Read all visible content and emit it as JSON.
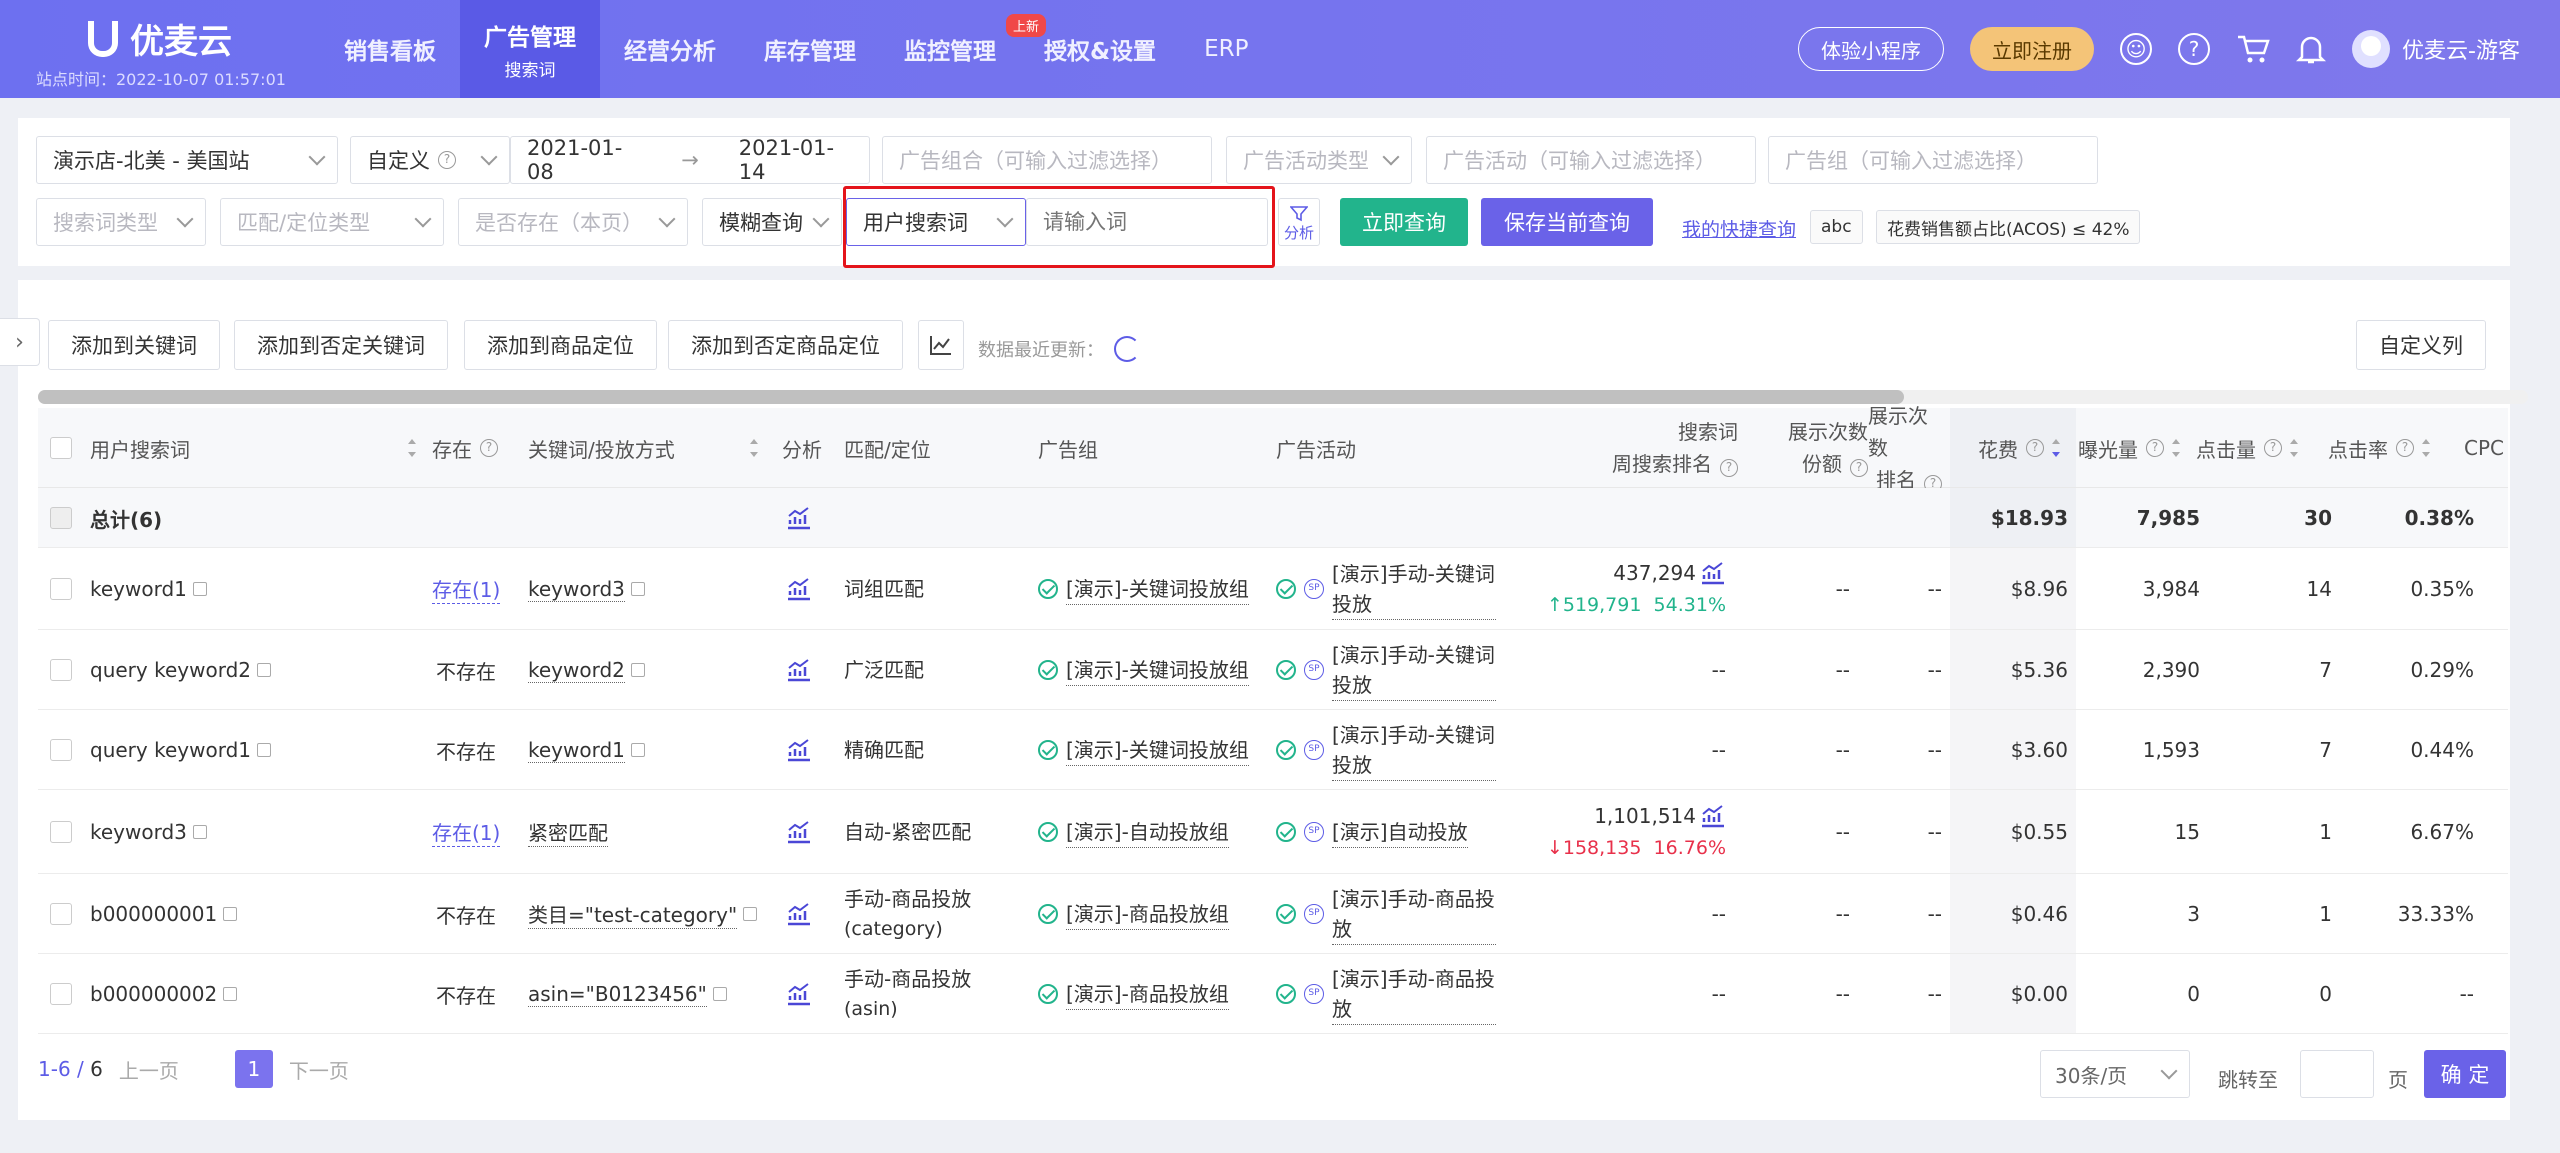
{
  "brand": {
    "name": "优麦云",
    "site_time": "站点时间：2022-10-07 01:57:01"
  },
  "nav": [
    {
      "label": "销售看板"
    },
    {
      "label": "广告管理",
      "sub": "搜索词",
      "active": true
    },
    {
      "label": "经营分析"
    },
    {
      "label": "库存管理"
    },
    {
      "label": "监控管理",
      "badge": "上新"
    },
    {
      "label": "授权&设置"
    },
    {
      "label": "ERP"
    }
  ],
  "header_right": {
    "mini_program": "体验小程序",
    "register": "立即注册",
    "username": "优麦云-游客"
  },
  "filters": {
    "store": "演示店-北美 - 美国站",
    "date_mode": "自定义",
    "date_start": "2021-01-08",
    "date_arrow": "→",
    "date_end": "2021-01-14",
    "ad_group_combo": "广告组合（可输入过滤选择）",
    "campaign_type": "广告活动类型",
    "campaign": "广告活动（可输入过滤选择）",
    "ad_group": "广告组（可输入过滤选择）",
    "search_term_type": "搜索词类型",
    "match_type": "匹配/定位类型",
    "exists": "是否存在（本页）",
    "fuzzy": "模糊查询",
    "field": "用户搜索词",
    "input_placeholder": "请输入词",
    "analyze": "分析",
    "query_btn": "立即查询",
    "save_btn": "保存当前查询",
    "quick_link": "我的快捷查询",
    "tag1": "abc",
    "tag2": "花费销售额占比(ACOS) ≤ 42%"
  },
  "toolbar": {
    "add_keyword": "添加到关键词",
    "add_neg_keyword": "添加到否定关键词",
    "add_product": "添加到商品定位",
    "add_neg_product": "添加到否定商品定位",
    "updated": "数据最近更新：",
    "custom_cols": "自定义列"
  },
  "columns": {
    "term": "用户搜索词",
    "exists": "存在",
    "keyword": "关键词/投放方式",
    "analyze": "分析",
    "match": "匹配/定位",
    "group": "广告组",
    "campaign": "广告活动",
    "rank1": "搜索词",
    "rank2": "周搜索排名",
    "share1": "展示次数",
    "share2": "份额",
    "srank1": "展示次数",
    "srank2": "排名",
    "spend": "花费",
    "impr": "曝光量",
    "clicks": "点击量",
    "ctr": "点击率",
    "cpc": "CPC"
  },
  "total": {
    "label": "总计(6)",
    "spend": "$18.93",
    "impr": "7,985",
    "clicks": "30",
    "ctr": "0.38%"
  },
  "rows": [
    {
      "term": "keyword1",
      "exists": "存在(1)",
      "exists_link": true,
      "keyword": "keyword3",
      "match": "词组匹配",
      "group": "[演示]-关键词投放组",
      "campaign": "[演示]手动-关键词投放",
      "rank": "437,294",
      "rank_delta": "519,791",
      "rank_pct": "54.31%",
      "rank_dir": "up",
      "share": "--",
      "srank": "--",
      "spend": "$8.96",
      "impr": "3,984",
      "clicks": "14",
      "ctr": "0.35%"
    },
    {
      "term": "query keyword2",
      "exists": "不存在",
      "exists_link": false,
      "keyword": "keyword2",
      "match": "广泛匹配",
      "group": "[演示]-关键词投放组",
      "campaign": "[演示]手动-关键词投放",
      "rank": "--",
      "share": "--",
      "srank": "--",
      "spend": "$5.36",
      "impr": "2,390",
      "clicks": "7",
      "ctr": "0.29%"
    },
    {
      "term": "query keyword1",
      "exists": "不存在",
      "exists_link": false,
      "keyword": "keyword1",
      "match": "精确匹配",
      "group": "[演示]-关键词投放组",
      "campaign": "[演示]手动-关键词投放",
      "rank": "--",
      "share": "--",
      "srank": "--",
      "spend": "$3.60",
      "impr": "1,593",
      "clicks": "7",
      "ctr": "0.44%"
    },
    {
      "term": "keyword3",
      "exists": "存在(1)",
      "exists_link": true,
      "keyword": "紧密匹配",
      "match": "自动-紧密匹配",
      "group": "[演示]-自动投放组",
      "campaign": "[演示]自动投放",
      "rank": "1,101,514",
      "rank_delta": "158,135",
      "rank_pct": "16.76%",
      "rank_dir": "down",
      "share": "--",
      "srank": "--",
      "spend": "$0.55",
      "impr": "15",
      "clicks": "1",
      "ctr": "6.67%"
    },
    {
      "term": "b000000001",
      "exists": "不存在",
      "exists_link": false,
      "keyword": "类目=\"test-category\"",
      "match": "手动-商品投放",
      "match_sub": "(category)",
      "group": "[演示]-商品投放组",
      "campaign": "[演示]手动-商品投放",
      "rank": "--",
      "share": "--",
      "srank": "--",
      "spend": "$0.46",
      "impr": "3",
      "clicks": "1",
      "ctr": "33.33%"
    },
    {
      "term": "b000000002",
      "exists": "不存在",
      "exists_link": false,
      "keyword": "asin=\"B0123456\"",
      "match": "手动-商品投放",
      "match_sub": "(asin)",
      "group": "[演示]-商品投放组",
      "campaign": "[演示]手动-商品投放",
      "rank": "--",
      "share": "--",
      "srank": "--",
      "spend": "$0.00",
      "impr": "0",
      "clicks": "0",
      "ctr": "--"
    }
  ],
  "pager": {
    "range": "1-6",
    "sep": "/",
    "total": "6",
    "prev": "上一页",
    "page": "1",
    "next": "下一页",
    "size": "30条/页",
    "jump": "跳转至",
    "page_unit": "页",
    "ok": "确 定"
  },
  "colors": {
    "brand": "#6d70f0",
    "accent": "#5d5ce6",
    "green": "#22b48c",
    "red": "#e4141b"
  }
}
